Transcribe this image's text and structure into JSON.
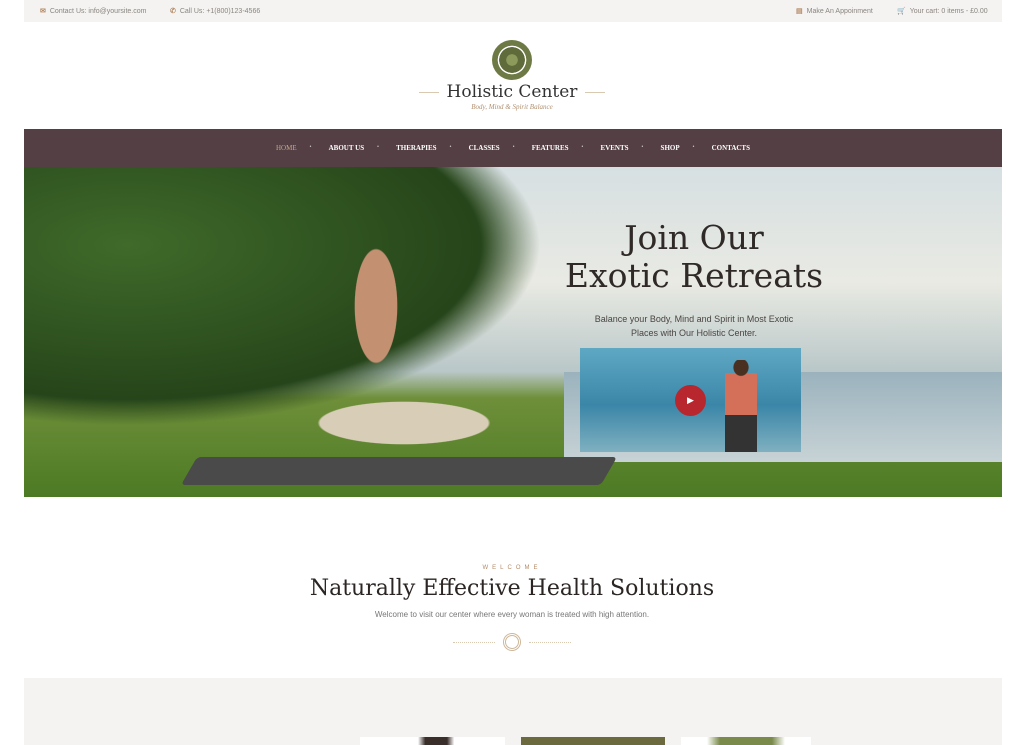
{
  "topbar": {
    "contact": "Contact Us: info@yoursite.com",
    "call": "Call Us: +1(800)123-4566",
    "appointment": "Make An Appoinment",
    "cart": "Your cart: 0 items - £0.00"
  },
  "logo": {
    "name": "Holistic Center",
    "tagline": "Body, Mind & Spirit Balance"
  },
  "nav": [
    "HOME",
    "ABOUT US",
    "THERAPIES",
    "CLASSES",
    "FEATURES",
    "EVENTS",
    "SHOP",
    "CONTACTS"
  ],
  "hero": {
    "title_line1": "Join Our",
    "title_line2": "Exotic Retreats",
    "subtitle": "Balance your Body, Mind and Spirit in Most Exotic Places with Our Holistic Center."
  },
  "welcome": {
    "eyebrow": "WELCOME",
    "title": "Naturally Effective Health Solutions",
    "text": "Welcome to visit our center where every woman is treated with high attention."
  },
  "colors": {
    "nav_bg": "#533f44",
    "accent": "#b48a66",
    "play": "#b8272e"
  }
}
